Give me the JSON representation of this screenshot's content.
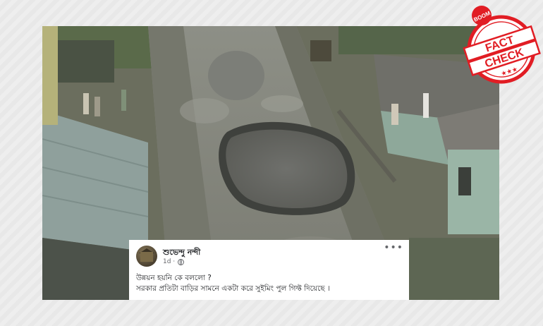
{
  "post": {
    "author": "শুভেন্দু নন্দী",
    "time": "1d ·",
    "privacy_icon": "globe-icon",
    "more_icon": "ellipsis-icon",
    "text_line1": "উন্নয়ন হয়নি কে বললো ?",
    "text_line2": "সরকার প্রতিটা বাড়ির সামনে একটা করে সুইমিং পুল গিফ্ট দিয়েছে ।"
  },
  "stamp": {
    "brand": "BOOM",
    "line1": "FACT",
    "line2": "CHECK",
    "color": "#e11d24"
  }
}
